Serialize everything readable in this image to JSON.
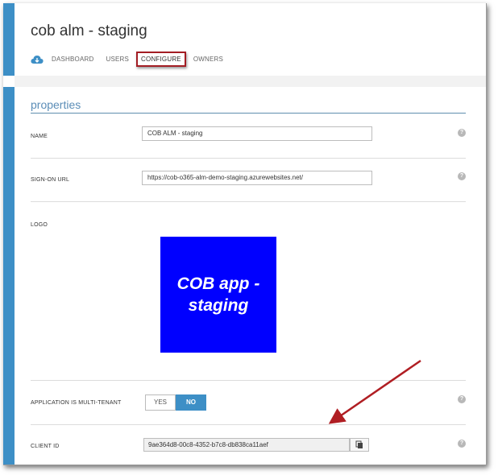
{
  "app": {
    "title": "cob alm - staging"
  },
  "nav": {
    "items": [
      {
        "label": "DASHBOARD"
      },
      {
        "label": "USERS"
      },
      {
        "label": "CONFIGURE"
      },
      {
        "label": "OWNERS"
      }
    ],
    "active": "CONFIGURE"
  },
  "properties": {
    "section_title": "properties",
    "name": {
      "label": "NAME",
      "value": "COB ALM - staging"
    },
    "sign_on_url": {
      "label": "SIGN-ON URL",
      "value": "https://cob-o365-alm-demo-staging.azurewebsites.net/"
    },
    "logo": {
      "label": "LOGO",
      "text": "COB app -\nstaging",
      "bg_color": "#0000ff"
    },
    "multi_tenant": {
      "label": "APPLICATION IS MULTI-TENANT",
      "yes_label": "YES",
      "no_label": "NO",
      "selected": "NO"
    },
    "client_id": {
      "label": "CLIENT ID",
      "value": "9ae364d8-00c8-4352-b7c8-db838ca11aef"
    },
    "help_glyph": "?"
  },
  "colors": {
    "accent": "#3d8fc6",
    "highlight_box": "#a31d24",
    "annotation_arrow": "#b01e23"
  },
  "icons": {
    "nav_cloud": "cloud-icon",
    "copy": "copy-icon",
    "help": "help-icon"
  }
}
